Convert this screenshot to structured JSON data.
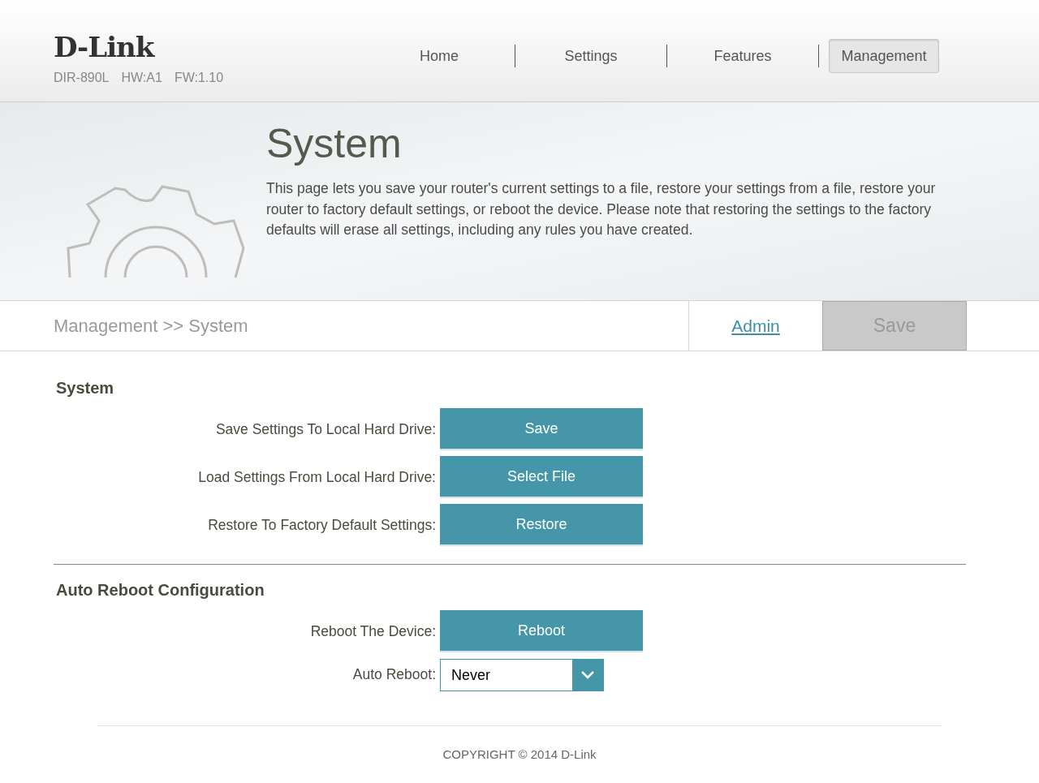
{
  "header": {
    "logo": "D-Link",
    "model": "DIR-890L",
    "hardware": "HW:A1",
    "firmware": "FW:1.10",
    "nav": [
      {
        "label": "Home",
        "selected": false
      },
      {
        "label": "Settings",
        "selected": false
      },
      {
        "label": "Features",
        "selected": false
      },
      {
        "label": "Management",
        "selected": true
      }
    ]
  },
  "banner": {
    "title": "System",
    "description": "This page lets you save your router's current settings to a file, restore your settings from a file, restore your router to factory default settings, or reboot the device. Please note that restoring the settings to the factory defaults will erase all settings, including any rules you have created."
  },
  "breadcrumb": "Management >> System",
  "actions": [
    {
      "kind": "link",
      "label": "Admin",
      "disabled": false
    },
    {
      "kind": "button",
      "label": "Save",
      "disabled": true
    }
  ],
  "sections": [
    {
      "title": "System",
      "rows": [
        {
          "kind": "button",
          "label": "Save Settings To Local Hard Drive:",
          "button": "Save"
        },
        {
          "kind": "button",
          "label": "Load Settings From Local Hard Drive:",
          "button": "Select File"
        },
        {
          "kind": "button",
          "label": "Restore To Factory Default Settings:",
          "button": "Restore"
        }
      ]
    },
    {
      "title": "Auto Reboot Configuration",
      "rows": [
        {
          "kind": "button",
          "label": "Reboot The Device:",
          "button": "Reboot"
        },
        {
          "kind": "select",
          "label": "Auto Reboot:",
          "value": "Never"
        }
      ]
    }
  ],
  "footer": "COPYRIGHT © 2014 D-Link"
}
